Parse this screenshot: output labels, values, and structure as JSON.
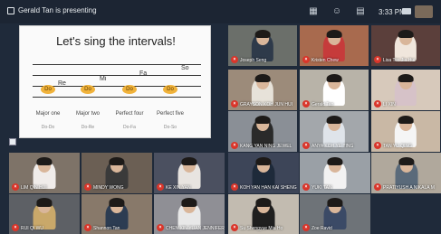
{
  "topbar": {
    "presenting": "Gerald Tan is presenting",
    "clock": "3:33 PM",
    "icons": [
      "present-icon",
      "grid-view-icon",
      "people-icon",
      "chat-icon",
      "camera-icon"
    ]
  },
  "slide": {
    "title": "Let's sing the intervals!",
    "notes": [
      "Do",
      "Do",
      "Do",
      "Do"
    ],
    "intervals": [
      "Major one",
      "Major two",
      "Perfect four",
      "Perfect five"
    ],
    "sub_labels": [
      "Do-Do",
      "Do-Re",
      "Do-Fa",
      "Do-So"
    ],
    "symbols": [
      "Re",
      "Mi",
      "Fa",
      "So"
    ]
  },
  "participants": [
    {
      "name": "Joseph Seng",
      "active": false
    },
    {
      "name": "Kristen Chew",
      "active": false
    },
    {
      "name": "Lisa Teo Jia Hui",
      "active": false
    },
    {
      "name": "GRAYSON KOH JUN HUI",
      "active": false
    },
    {
      "name": "Gerald Tan",
      "active": true
    },
    {
      "name": "LI XIN",
      "active": false
    },
    {
      "name": "KANG YAN NING JEWEL",
      "active": false
    },
    {
      "name": "ANYA KOH YE TING",
      "active": false
    },
    {
      "name": "TAN YU QING",
      "active": false
    },
    {
      "name": "LIM QIN HUI",
      "active": false
    },
    {
      "name": "MINDY WONG",
      "active": false
    },
    {
      "name": "KE XIN YAN",
      "active": false
    },
    {
      "name": "KOH YAN HAN KAI SHENG",
      "active": false
    },
    {
      "name": "YUKI TAN",
      "active": false
    },
    {
      "name": "PRATIYUSH A NIKALA M",
      "active": false
    },
    {
      "name": "RUI QI WU",
      "active": false
    },
    {
      "name": "Shannon Tan",
      "active": false
    },
    {
      "name": "CHEN XIN YUAN JENNIFER",
      "active": false
    },
    {
      "name": "Su Shengyue Mia Ho",
      "active": false
    },
    {
      "name": "Zoe Ravid",
      "active": false
    }
  ],
  "colors": {
    "topbar": "#1c2533",
    "mute": "#d9352a",
    "note": "#f0b23a"
  }
}
